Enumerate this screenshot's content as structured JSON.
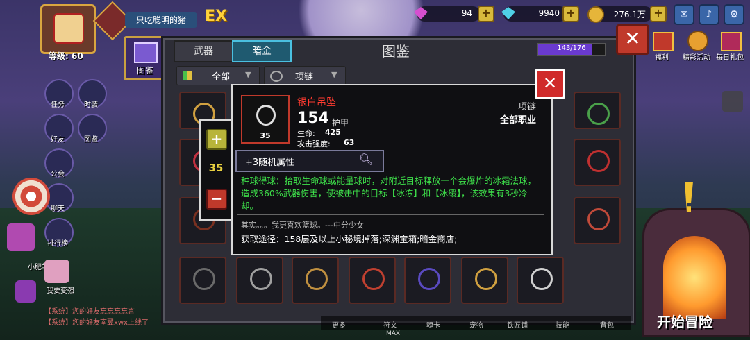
{
  "player": {
    "name": "只吃聪明的猪",
    "level": "等级: 60",
    "badge": "EX"
  },
  "resources": {
    "crystal": "94",
    "diamond": "9940",
    "gold": "276.1万"
  },
  "top_right_icons": [
    "mail-icon",
    "sound-icon",
    "settings-icon"
  ],
  "events": [
    {
      "label": "福利",
      "icon": "gift-icon"
    },
    {
      "label": "精彩活动",
      "icon": "event-icon"
    },
    {
      "label": "每日礼包",
      "icon": "daily-gift-icon"
    }
  ],
  "side_menu": [
    {
      "label": "图鉴"
    },
    {
      "label": "任务"
    },
    {
      "label": "时装"
    },
    {
      "label": "好友"
    },
    {
      "label": "图鉴"
    },
    {
      "label": "公会"
    },
    {
      "label": "聊天"
    },
    {
      "label": "排行榜"
    }
  ],
  "side_chars": [
    {
      "label": "小肥羊"
    },
    {
      "label": "我要变强"
    }
  ],
  "chat": [
    {
      "tag": "【系统】",
      "text": "您的好友忘忘忘忘言"
    },
    {
      "tag": "【系统】",
      "text": "您的好友南翼xwx上线了"
    }
  ],
  "codex": {
    "title": "图鉴",
    "tabs": [
      "武器",
      "暗金"
    ],
    "active_tab": 1,
    "progress": "143/176",
    "progress_fraction": 0.8125,
    "filter_category": "全部",
    "filter_slot": "项链"
  },
  "item": {
    "name": "银白吊坠",
    "name_color": "#ff3b30",
    "icon_level": "35",
    "power": "154",
    "power_label": "护甲",
    "stats": [
      {
        "label": "生命:",
        "value": "425"
      },
      {
        "label": "攻击强度:",
        "value": "63"
      }
    ],
    "slot": "项链",
    "class": "全部职业",
    "random_attr": "+3随机属性",
    "effect": "种球得球：拾取生命球或能量球时，对附近目标释放一个会爆炸的冰霜法球，造成360%武器伤害，使被击中的目标【冰冻】和【冰缓】，该效果有3秒冷却。",
    "flavor": "其实。。。我更喜欢篮球。---中分少女",
    "source": "获取途径：158层及以上小秘境掉落;深渊宝箱;暗金商店;"
  },
  "quantity": "35",
  "bottom_tabs": [
    "更多",
    "符文",
    "魂卡",
    "宠物",
    "铁匠铺",
    "技能",
    "背包"
  ],
  "start_button": "开始冒险",
  "max_label": "MAX"
}
